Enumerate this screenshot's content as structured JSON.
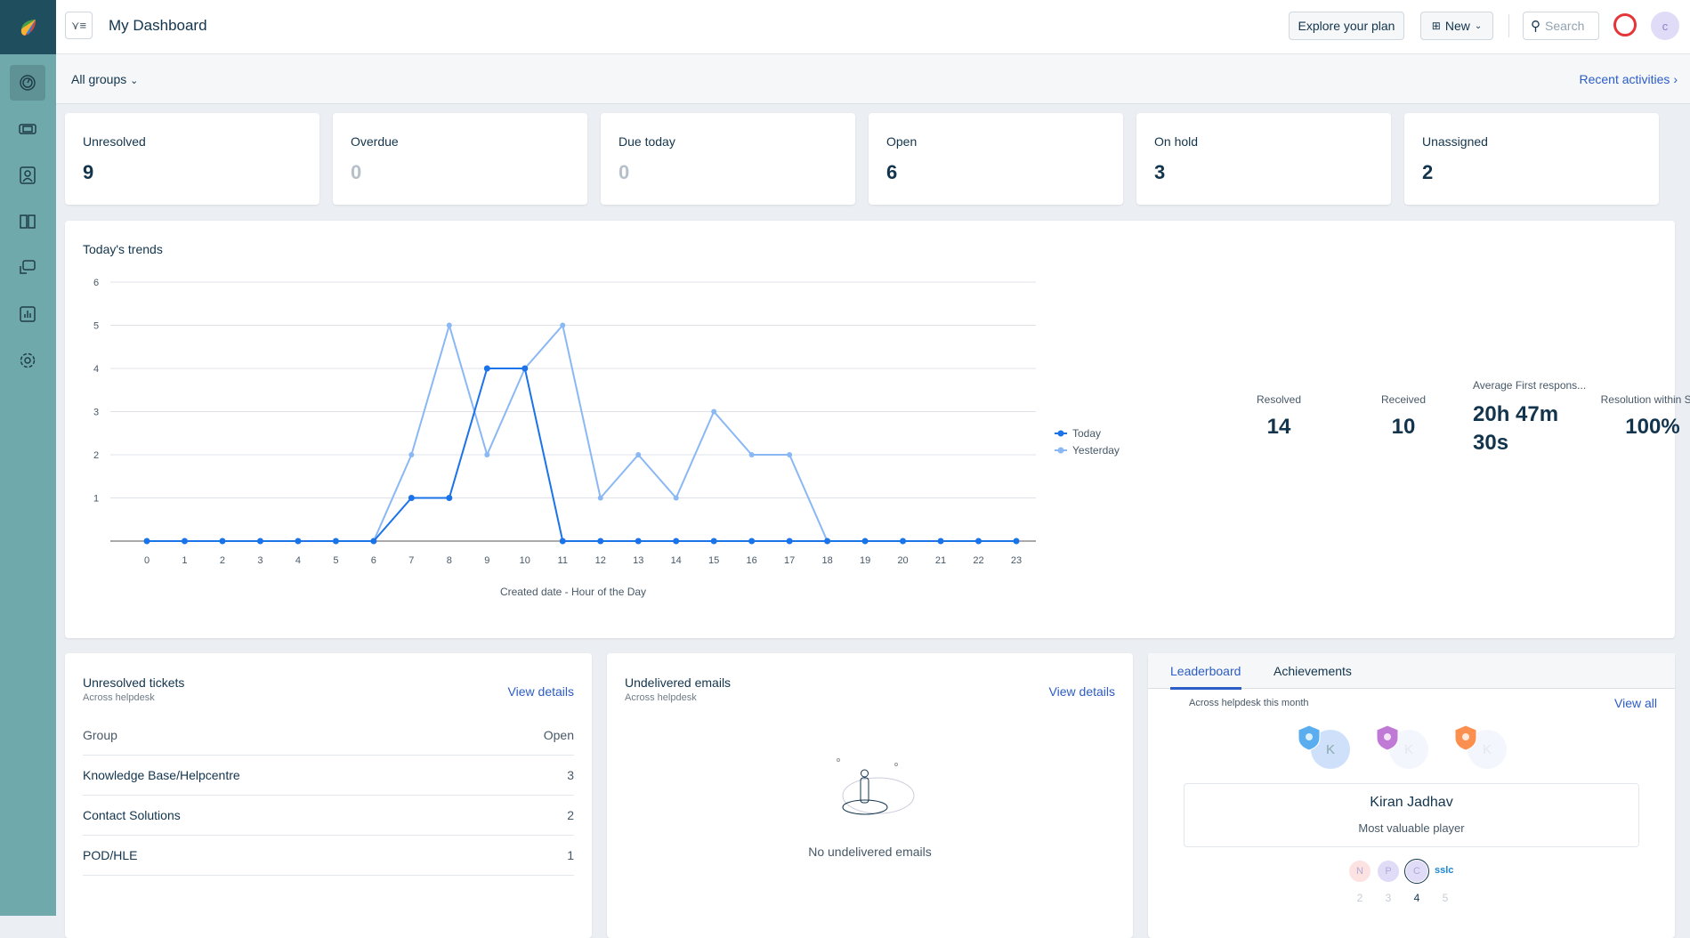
{
  "header": {
    "title": "My Dashboard",
    "explore": "Explore your plan",
    "new": "New",
    "search_placeholder": "Search",
    "avatar": "c"
  },
  "groupbar": {
    "groups": "All groups",
    "recent": "Recent activities"
  },
  "stats": [
    {
      "label": "Unresolved",
      "value": "9",
      "active": true
    },
    {
      "label": "Overdue",
      "value": "0",
      "active": false
    },
    {
      "label": "Due today",
      "value": "0",
      "active": false
    },
    {
      "label": "Open",
      "value": "6",
      "active": true
    },
    {
      "label": "On hold",
      "value": "3",
      "active": true
    },
    {
      "label": "Unassigned",
      "value": "2",
      "active": true
    }
  ],
  "trends": {
    "title": "Today's trends",
    "metrics": [
      {
        "label": "Resolved",
        "value": "14"
      },
      {
        "label": "Received",
        "value": "10"
      },
      {
        "label": "Average First respons...",
        "value": "20h 47m 30s"
      },
      {
        "label": "Resolution within SLA",
        "value": "100%"
      }
    ]
  },
  "chart_data": {
    "type": "line",
    "title": "Today's trends",
    "xlabel": "Created date - Hour of the Day",
    "ylabel": "",
    "ylim": [
      0,
      6
    ],
    "yticks": [
      "0",
      "1",
      "2",
      "3",
      "4",
      "5",
      "6"
    ],
    "x": [
      "0",
      "1",
      "2",
      "3",
      "4",
      "5",
      "6",
      "7",
      "8",
      "9",
      "10",
      "11",
      "12",
      "13",
      "14",
      "15",
      "16",
      "17",
      "18",
      "19",
      "20",
      "21",
      "22",
      "23"
    ],
    "legend_position": "right",
    "series": [
      {
        "name": "Today",
        "color": "#1a73e8",
        "values": [
          0,
          0,
          0,
          0,
          0,
          0,
          0,
          1,
          1,
          4,
          4,
          0,
          0,
          0,
          0,
          0,
          0,
          0,
          0,
          0,
          0,
          0,
          0,
          0
        ]
      },
      {
        "name": "Yesterday",
        "color": "#8ab8f5",
        "values": [
          0,
          0,
          0,
          0,
          0,
          0,
          0,
          2,
          5,
          2,
          4,
          5,
          1,
          2,
          1,
          3,
          2,
          2,
          0,
          0,
          0,
          0,
          0,
          0
        ]
      }
    ]
  },
  "unresolved": {
    "title": "Unresolved tickets",
    "subtitle": "Across helpdesk",
    "view": "View details",
    "col_group": "Group",
    "col_open": "Open",
    "rows": [
      {
        "group": "Knowledge Base/Helpcentre",
        "open": "3"
      },
      {
        "group": "Contact Solutions",
        "open": "2"
      },
      {
        "group": "POD/HLE",
        "open": "1"
      }
    ]
  },
  "undelivered": {
    "title": "Undelivered emails",
    "subtitle": "Across helpdesk",
    "view": "View details",
    "empty": "No undelivered emails"
  },
  "leaderboard": {
    "tabs": [
      "Leaderboard",
      "Achievements"
    ],
    "subtitle": "Across helpdesk this month",
    "view_all": "View all",
    "avatar_initial": "K",
    "name": "Kiran Jadhav",
    "role": "Most valuable player",
    "ranks": [
      {
        "initial": "N",
        "num": "2",
        "color": "#fde2e2"
      },
      {
        "initial": "P",
        "num": "3",
        "color": "#e0dbf6"
      },
      {
        "initial": "C",
        "num": "4",
        "color": "#e0dbf6"
      },
      {
        "initial": "sslc",
        "num": "5",
        "color": ""
      }
    ]
  }
}
